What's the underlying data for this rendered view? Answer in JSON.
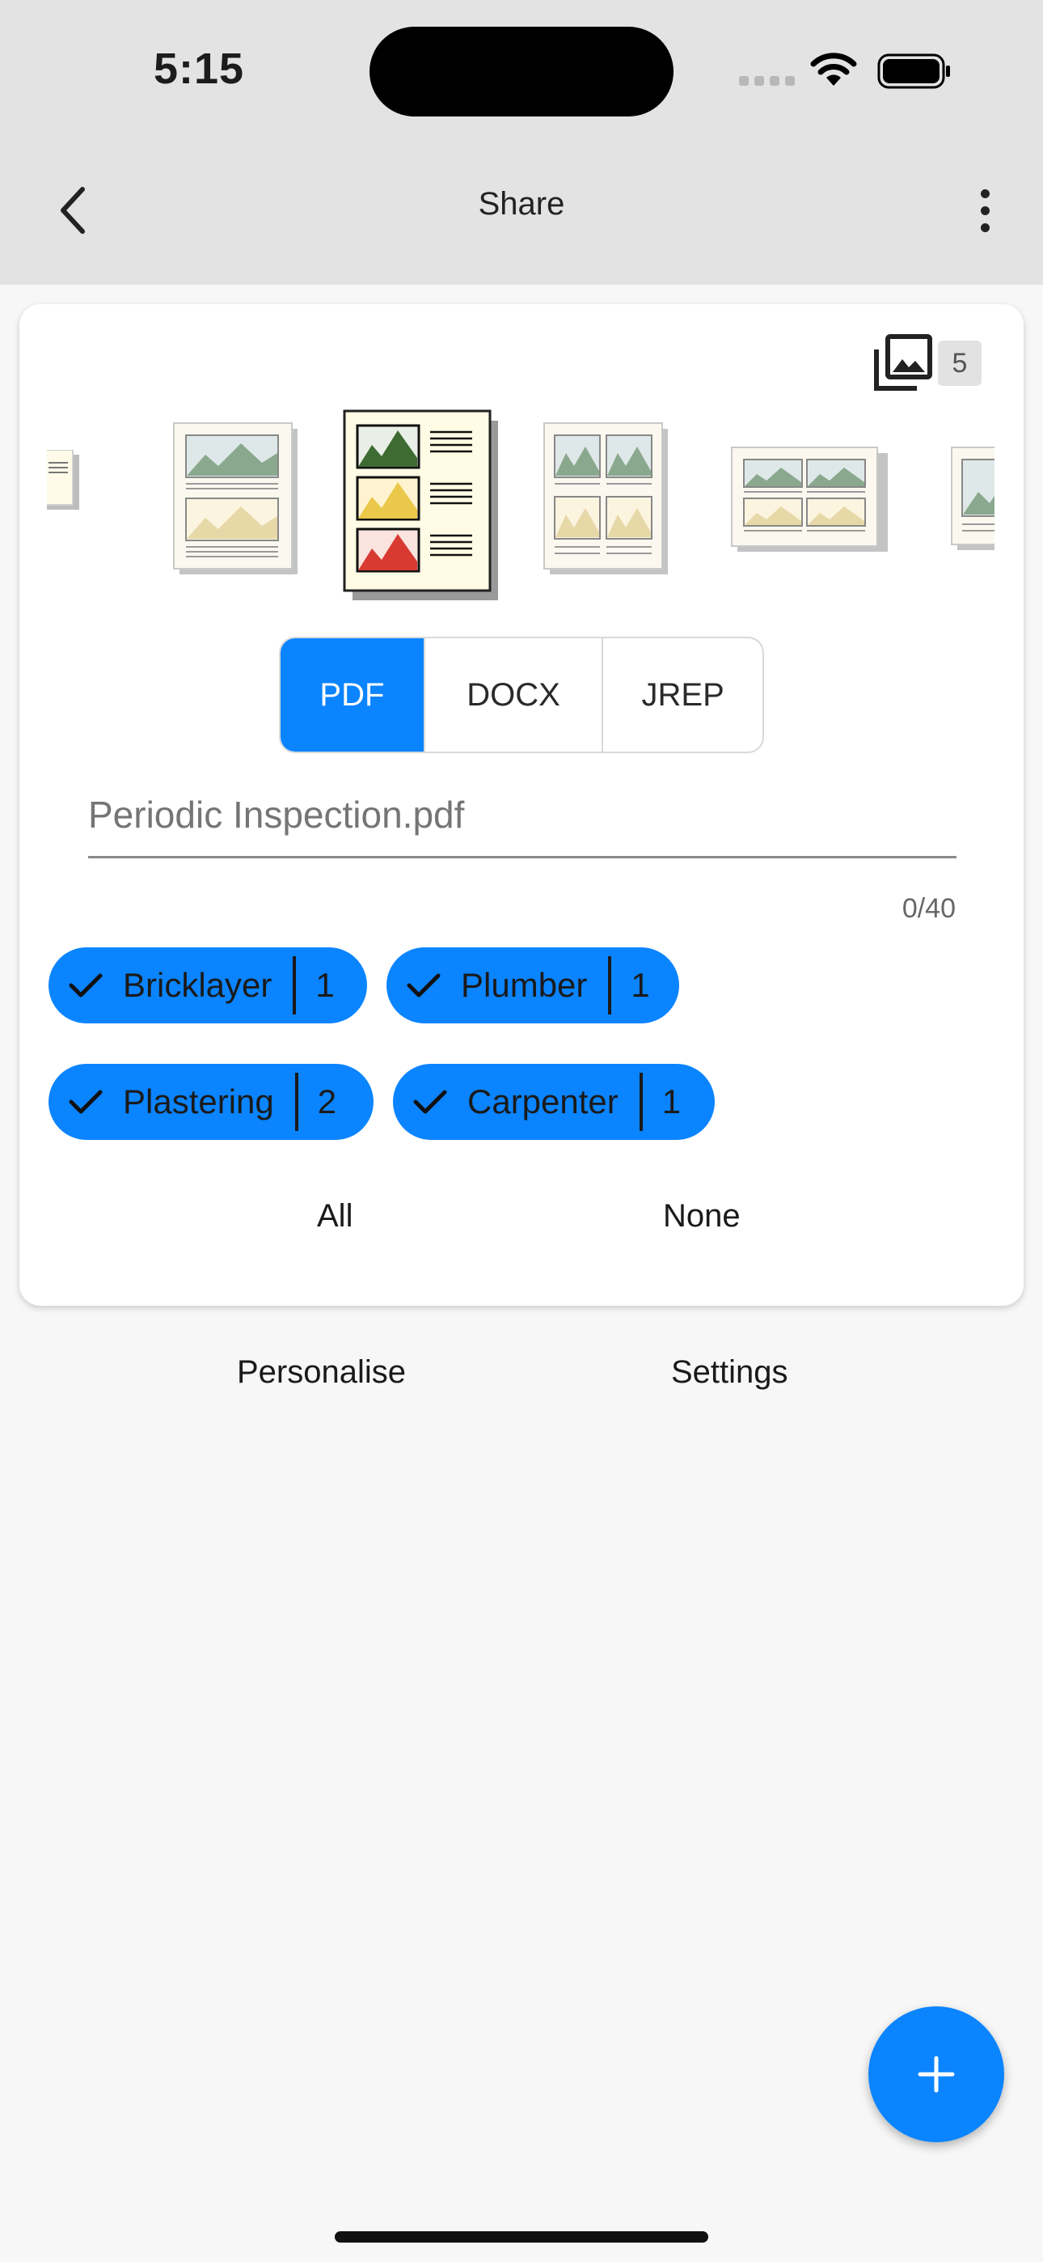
{
  "status_bar": {
    "time": "5:15"
  },
  "app_bar": {
    "title": "Share",
    "back_icon": "chevron-left-icon",
    "menu_icon": "more-vertical-icon"
  },
  "card": {
    "photo_count": "5",
    "layouts": [
      {
        "name": "list-layout"
      },
      {
        "name": "two-photo-layout"
      },
      {
        "name": "three-photo-with-text-layout",
        "selected": true
      },
      {
        "name": "four-photo-grid-layout"
      },
      {
        "name": "four-photo-landscape-layout"
      },
      {
        "name": "single-photo-layout"
      }
    ],
    "formats": [
      "PDF",
      "DOCX",
      "JREP"
    ],
    "selected_format": "PDF",
    "filename": {
      "placeholder": "Periodic Inspection.pdf",
      "value": "",
      "counter": "0/40"
    },
    "chips": [
      {
        "label": "Bricklayer",
        "count": "1",
        "checked": true
      },
      {
        "label": "Plumber",
        "count": "1",
        "checked": true
      },
      {
        "label": "Plastering",
        "count": "2",
        "checked": true
      },
      {
        "label": "Carpenter",
        "count": "1",
        "checked": true
      }
    ],
    "select_all": "All",
    "select_none": "None"
  },
  "actions": {
    "personalise": "Personalise",
    "settings": "Settings"
  },
  "colors": {
    "accent": "#0b84ff",
    "app_bar": "#e3e3e3",
    "background": "#f7f7f7"
  }
}
